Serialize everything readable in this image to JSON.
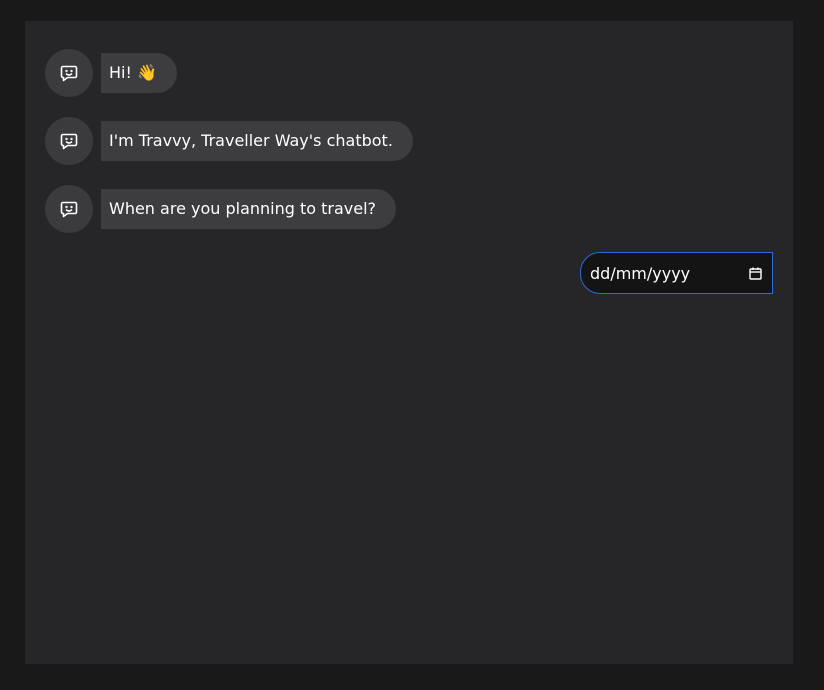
{
  "chat": {
    "messages": [
      {
        "sender": "bot",
        "icon": "chatbot-icon",
        "text": "Hi! 👋"
      },
      {
        "sender": "bot",
        "icon": "chatbot-icon",
        "text": "I'm Travvy, Traveller Way's chatbot."
      },
      {
        "sender": "bot",
        "icon": "chatbot-icon",
        "text": "When are you planning to travel?"
      }
    ],
    "date_input": {
      "placeholder": "dd/mm/yyyy",
      "icon": "calendar-icon"
    }
  },
  "colors": {
    "page_background": "#191919",
    "panel_background": "#262628",
    "bubble_background": "#3d3d3f",
    "avatar_background": "#3b3b3d",
    "input_border": "#2f6bd9",
    "text": "#ffffff"
  }
}
